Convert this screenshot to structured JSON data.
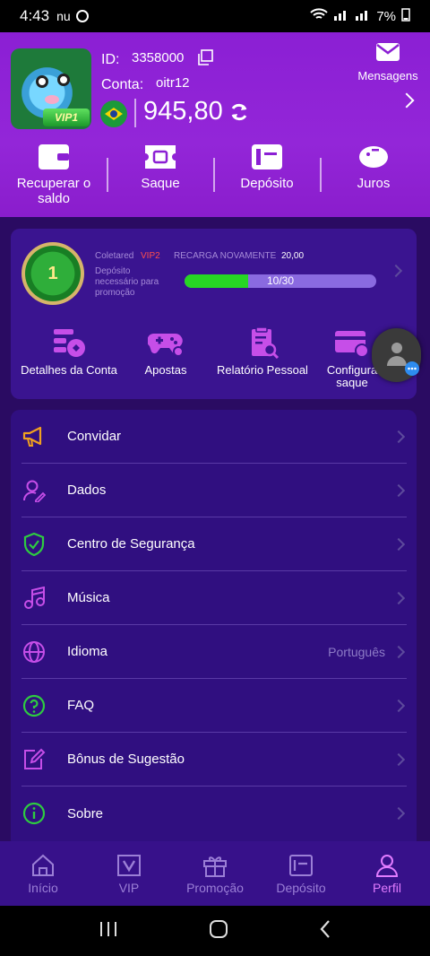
{
  "status_bar": {
    "time": "4:43",
    "left_icons": "nu",
    "battery": "7%"
  },
  "profile": {
    "id_label": "ID:",
    "id_value": "3358000",
    "account_label": "Conta:",
    "account_value": "oitr12",
    "vip_badge": "VIP1",
    "balance": "945,80",
    "messages_label": "Mensagens"
  },
  "quick_actions": [
    {
      "label": "Recuperar o saldo",
      "icon": "wallet-icon"
    },
    {
      "label": "Saque",
      "icon": "ticket-icon"
    },
    {
      "label": "Depósito",
      "icon": "deposit-card-icon"
    },
    {
      "label": "Juros",
      "icon": "piggy-bank-icon"
    }
  ],
  "vip_card": {
    "medal_level": "1",
    "collected_label": "Coletared",
    "vip_next": "VIP2",
    "recharge_label": "RECARGA NOVAMENTE",
    "recharge_value": "20,00",
    "deposit_note": "Depósito necessário para promoção",
    "progress_text": "10/30",
    "progress_current": 10,
    "progress_total": 30
  },
  "features": [
    {
      "label": "Detalhes da Conta",
      "icon": "account-details-icon"
    },
    {
      "label": "Apostas",
      "icon": "gamepad-icon"
    },
    {
      "label": "Relatório Pessoal",
      "icon": "report-icon"
    },
    {
      "label": "Configura saque",
      "icon": "withdraw-settings-icon"
    }
  ],
  "menu": [
    {
      "label": "Convidar",
      "icon": "megaphone-icon",
      "value": ""
    },
    {
      "label": "Dados",
      "icon": "user-edit-icon",
      "value": ""
    },
    {
      "label": "Centro de Segurança",
      "icon": "shield-icon",
      "value": ""
    },
    {
      "label": "Música",
      "icon": "music-icon",
      "value": ""
    },
    {
      "label": "Idioma",
      "icon": "globe-icon",
      "value": "Português"
    },
    {
      "label": "FAQ",
      "icon": "question-icon",
      "value": ""
    },
    {
      "label": "Bônus de Sugestão",
      "icon": "edit-icon",
      "value": ""
    },
    {
      "label": "Sobre",
      "icon": "info-icon",
      "value": ""
    }
  ],
  "bottom_nav": [
    {
      "label": "Início",
      "icon": "home-icon",
      "active": false
    },
    {
      "label": "VIP",
      "icon": "vip-icon",
      "active": false
    },
    {
      "label": "Promoção",
      "icon": "gift-icon",
      "active": false
    },
    {
      "label": "Depósito",
      "icon": "deposit-icon",
      "active": false
    },
    {
      "label": "Perfil",
      "icon": "profile-icon",
      "active": true
    }
  ],
  "colors": {
    "header": "#8b1fd4",
    "accent_green": "#27d624",
    "vip_red": "#ff4d4d",
    "active_nav": "#e27cff"
  }
}
